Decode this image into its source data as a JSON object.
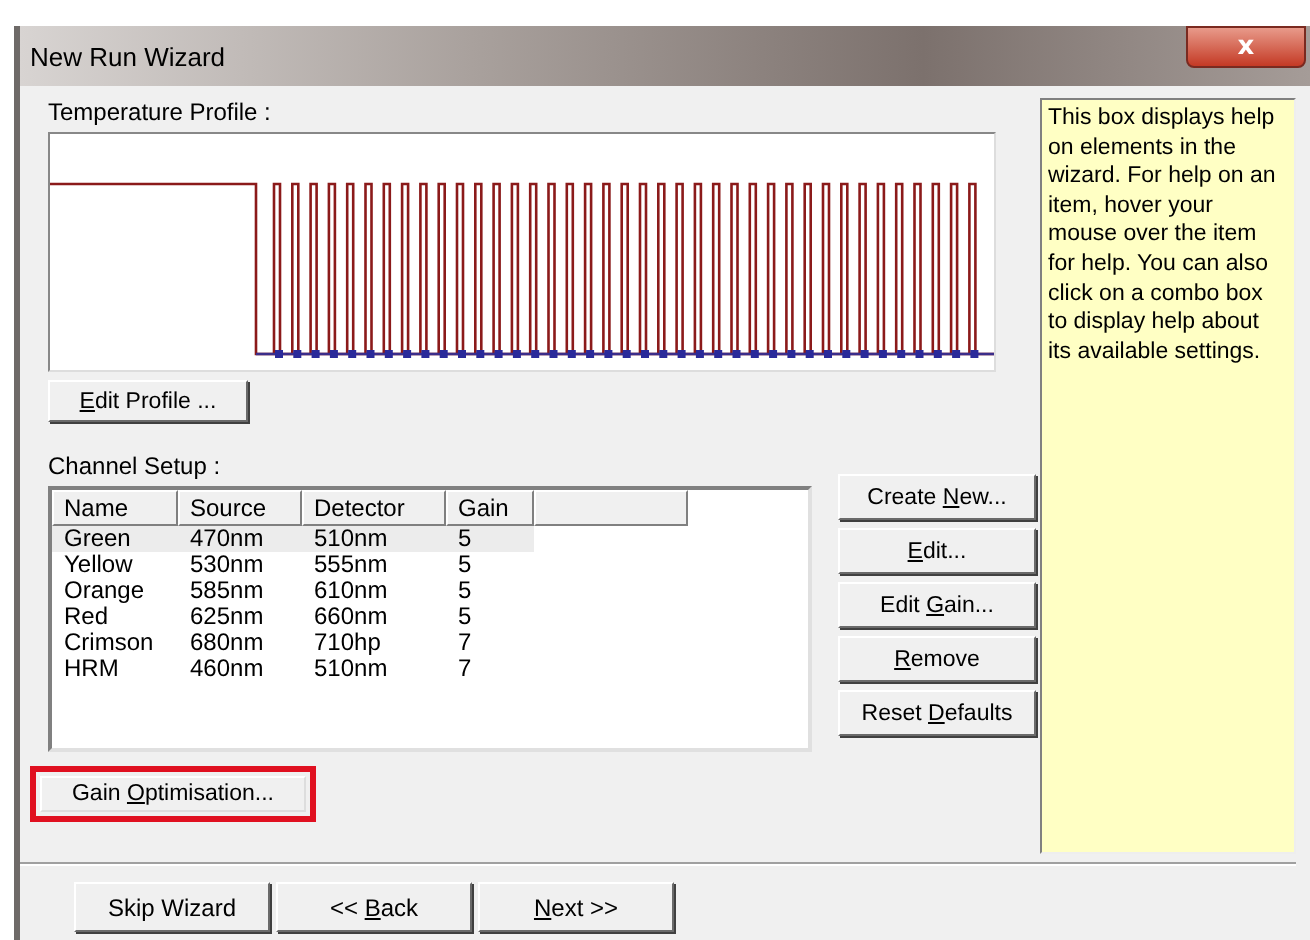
{
  "window": {
    "title": "New Run Wizard",
    "close": "x"
  },
  "temperature_profile": {
    "label": "Temperature Profile :",
    "edit_button": {
      "key": "E",
      "after": "dit Profile ..."
    }
  },
  "channel_setup": {
    "label": "Channel Setup :",
    "columns": [
      "Name",
      "Source",
      "Detector",
      "Gain"
    ],
    "rows": [
      {
        "cells": [
          "Green",
          "470nm",
          "510nm",
          "5"
        ],
        "selected": true
      },
      {
        "cells": [
          "Yellow",
          "530nm",
          "555nm",
          "5"
        ],
        "selected": false
      },
      {
        "cells": [
          "Orange",
          "585nm",
          "610nm",
          "5"
        ],
        "selected": false
      },
      {
        "cells": [
          "Red",
          "625nm",
          "660nm",
          "5"
        ],
        "selected": false
      },
      {
        "cells": [
          "Crimson",
          "680nm",
          "710hp",
          "7"
        ],
        "selected": false
      },
      {
        "cells": [
          "HRM",
          "460nm",
          "510nm",
          "7"
        ],
        "selected": false
      }
    ],
    "buttons": [
      {
        "before": "Create ",
        "key": "N",
        "after": "ew..."
      },
      {
        "key": "E",
        "after": "dit..."
      },
      {
        "before": "Edit ",
        "key": "G",
        "after": "ain..."
      },
      {
        "key": "R",
        "after": "emove"
      },
      {
        "before": "Reset ",
        "key": "D",
        "after": "efaults"
      }
    ],
    "gain_button": {
      "label": {
        "before": "Gain ",
        "key": "O",
        "after": "ptimisation..."
      },
      "highlighted": true
    }
  },
  "help": {
    "text": "This box displays help on elements in the wizard. For help on an item, hover your mouse over the item for help. You can also click on a combo box to display help about its available settings."
  },
  "footer_buttons": [
    {
      "before": "Skip Wizard"
    },
    {
      "before": "<< ",
      "key": "B",
      "after": "ack"
    },
    {
      "key": "N",
      "after": "ext >>"
    }
  ]
}
